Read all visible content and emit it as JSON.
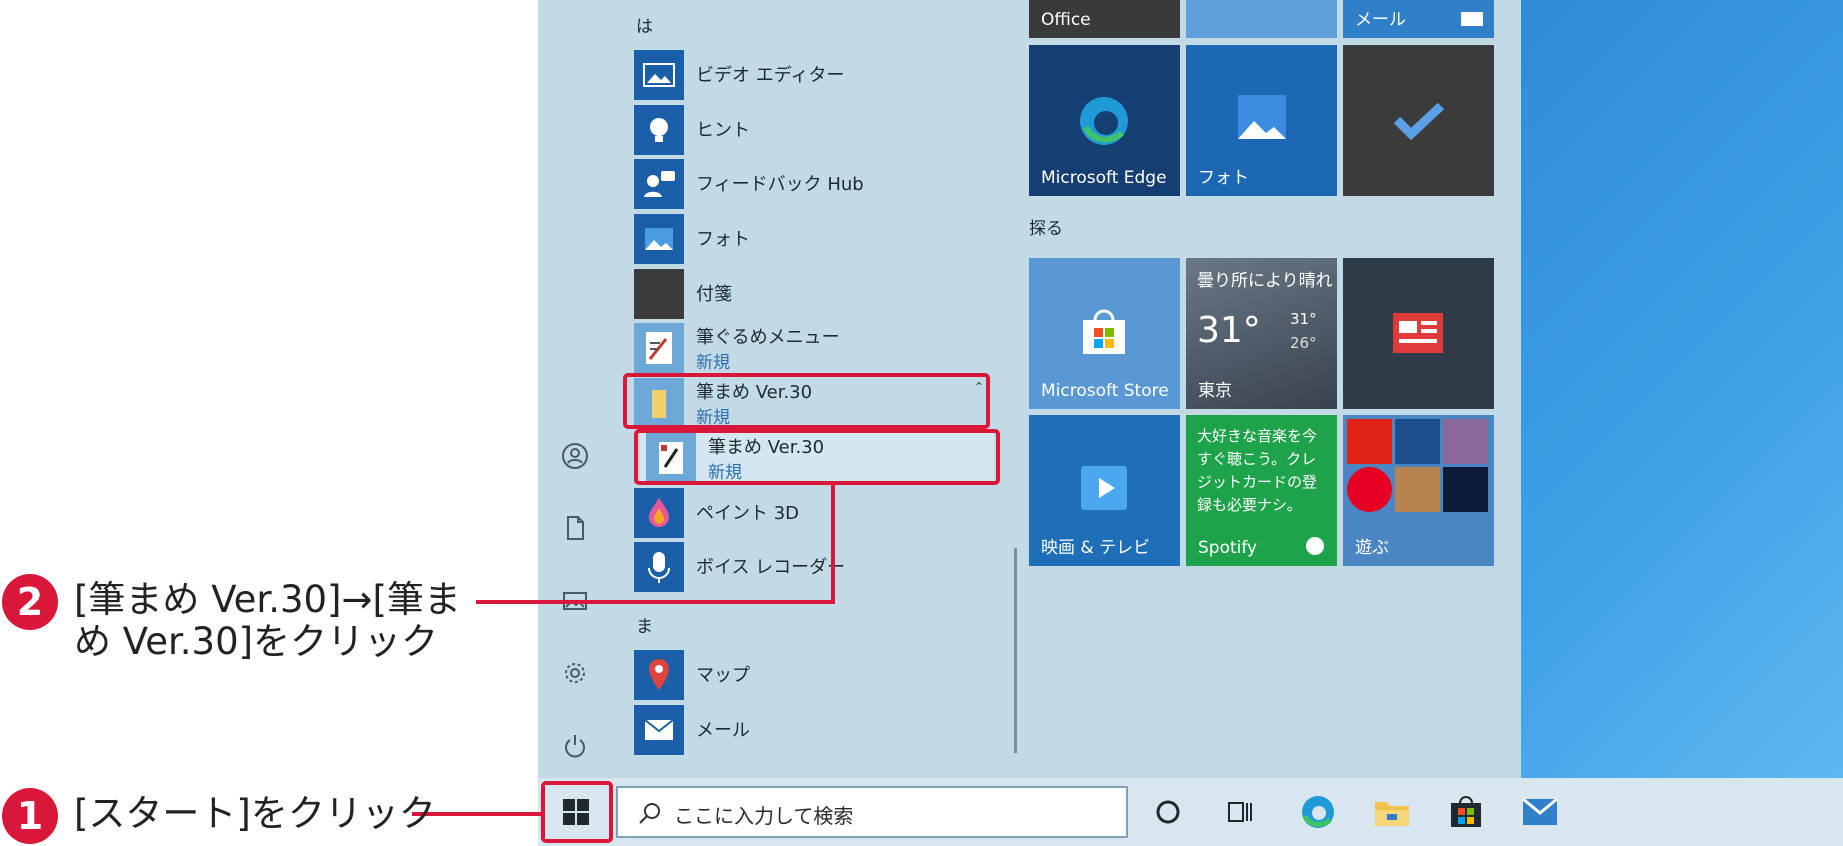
{
  "app_list": {
    "section_ha": "は",
    "section_ma": "ま",
    "items": [
      {
        "name": "ビデオ エディター",
        "badge": ""
      },
      {
        "name": "ヒント",
        "badge": ""
      },
      {
        "name": "フィードバック Hub",
        "badge": ""
      },
      {
        "name": "フォト",
        "badge": ""
      },
      {
        "name": "付箋",
        "badge": ""
      },
      {
        "name": "筆ぐるめメニュー",
        "badge": "新規"
      },
      {
        "name": "筆まめ Ver.30",
        "badge": "新規"
      },
      {
        "name": "筆まめ Ver.30",
        "badge": "新規"
      },
      {
        "name": "ペイント 3D",
        "badge": ""
      },
      {
        "name": "ボイス レコーダー",
        "badge": ""
      },
      {
        "name": "マップ",
        "badge": ""
      },
      {
        "name": "メール",
        "badge": ""
      }
    ]
  },
  "tiles": {
    "office": "Office",
    "mail": "メール",
    "edge": "Microsoft Edge",
    "photos": "フォト",
    "group_explore": "探る",
    "store": "Microsoft Store",
    "weather": {
      "condition": "曇り所により晴れ",
      "temp": "31°",
      "high": "31°",
      "low": "26°",
      "city": "東京"
    },
    "movies": "映画 & テレビ",
    "spotify": {
      "text": "大好きな音楽を今すぐ聴こう。クレジットカードの登録も必要ナシ。",
      "label": "Spotify"
    },
    "play": "遊ぶ"
  },
  "taskbar": {
    "search_placeholder": "ここに入力して検索"
  },
  "callouts": {
    "step1_number": "1",
    "step1_text": "[スタート]をクリック",
    "step2_number": "2",
    "step2_line1": "[筆まめ Ver.30]→[筆ま",
    "step2_line2": "め Ver.30]をクリック"
  },
  "colors": {
    "accent_red": "#d8173a",
    "menu_bg": "#c1dae5",
    "tile_blue": "#1b5fa8",
    "badge_blue": "#2f6fae"
  }
}
